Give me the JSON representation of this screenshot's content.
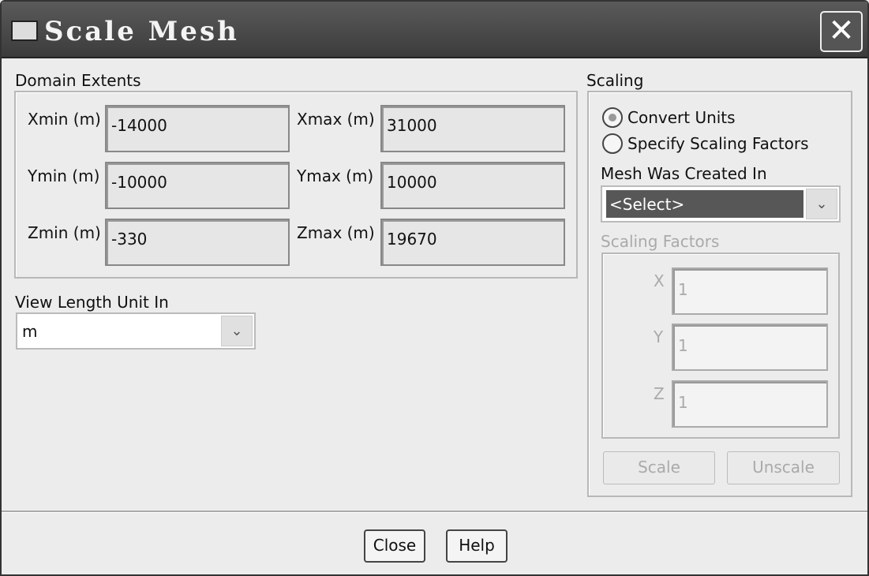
{
  "window": {
    "title": "Scale Mesh",
    "close_glyph": "✕"
  },
  "domain_extents": {
    "label": "Domain Extents",
    "fields": [
      {
        "label": "Xmin (m)",
        "value": "-14000"
      },
      {
        "label": "Xmax (m)",
        "value": "31000"
      },
      {
        "label": "Ymin (m)",
        "value": "-10000"
      },
      {
        "label": "Ymax (m)",
        "value": "10000"
      },
      {
        "label": "Zmin (m)",
        "value": "-330"
      },
      {
        "label": "Zmax (m)",
        "value": "19670"
      }
    ]
  },
  "view_length": {
    "label": "View Length Unit In",
    "value": "m"
  },
  "scaling": {
    "label": "Scaling",
    "convert_units": "Convert Units",
    "specify_factors": "Specify Scaling Factors",
    "mesh_created_label": "Mesh Was Created In",
    "mesh_created_value": "<Select>",
    "factors_label": "Scaling Factors",
    "factors": [
      {
        "label": "X",
        "value": "1"
      },
      {
        "label": "Y",
        "value": "1"
      },
      {
        "label": "Z",
        "value": "1"
      }
    ],
    "scale": "Scale",
    "unscale": "Unscale"
  },
  "footer": {
    "close": "Close",
    "help": "Help"
  }
}
